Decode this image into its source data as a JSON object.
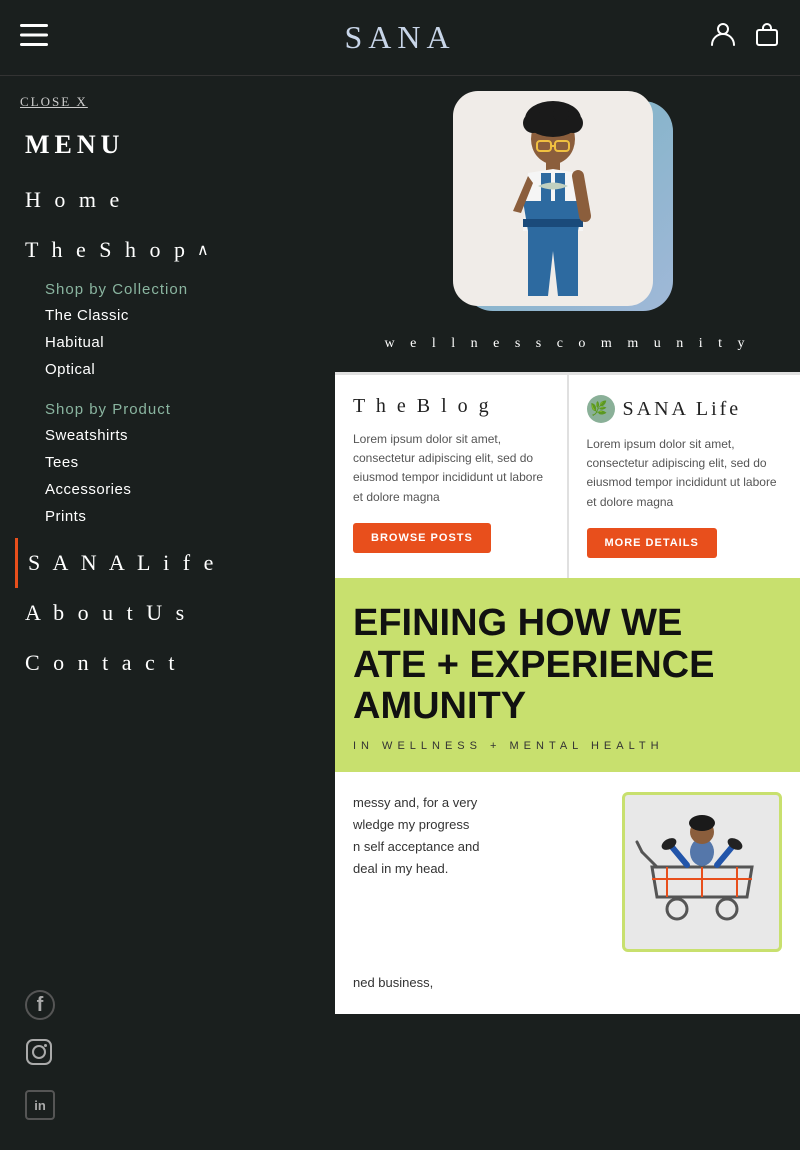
{
  "header": {
    "logo": "SANA",
    "hamburger_label": "☰",
    "user_icon": "👤",
    "bag_icon": "🛍"
  },
  "menu": {
    "close_label": "CLOSE X",
    "title": "MENU",
    "items": [
      {
        "label": "H o m e",
        "key": "home"
      },
      {
        "label": "T h e   S h o p",
        "key": "shop",
        "expanded": true
      },
      {
        "label": "S A N A   L i f e",
        "key": "sana-life"
      },
      {
        "label": "A b o u t   U s",
        "key": "about"
      },
      {
        "label": "C o n t a c t",
        "key": "contact"
      }
    ],
    "shop_submenu": {
      "by_collection_label": "Shop by Collection",
      "collection_items": [
        "The Classic",
        "Habitual",
        "Optical"
      ],
      "by_product_label": "Shop by Product",
      "product_items": [
        "Sweatshirts",
        "Tees",
        "Accessories",
        "Prints"
      ]
    },
    "social": {
      "facebook": "f",
      "instagram": "⊙",
      "linkedin": "in"
    }
  },
  "hero": {
    "tagline": "w e l l n e s s   c o m m u n i t y"
  },
  "blog": {
    "title": "T h e   B l o g",
    "text": "Lorem ipsum dolor sit amet, consectetur adipiscing elit, sed do eiusmod tempor incididunt ut labore et dolore magna",
    "button": "BROWSE POSTS"
  },
  "sana_life": {
    "title": "SANA Life",
    "text": "Lorem ipsum dolor sit amet, consectetur adipiscing elit, sed do eiusmod tempor incididunt ut labore et dolore magna",
    "button": "MORE DETAILS"
  },
  "green_hero": {
    "line1": "EFINING HOW WE",
    "line2": "ATE + EXPERIENCE",
    "line3": "AMUNITY",
    "subtitle": "IN WELLNESS + MENTAL HEALTH"
  },
  "article": {
    "text1": "messy and, for a very",
    "text2": "wledge my progress",
    "text3": "n self acceptance and",
    "text4": "deal in my head.",
    "text5": "ned business,"
  }
}
